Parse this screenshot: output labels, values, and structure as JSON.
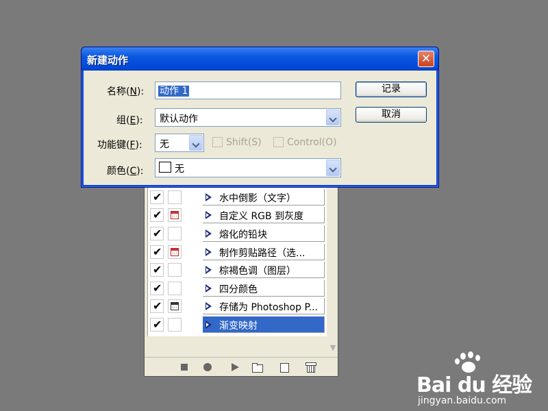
{
  "dialog": {
    "title": "新建动作",
    "fields": {
      "name": {
        "label_prefix": "名称(",
        "hotkey": "N",
        "label_suffix": "):",
        "value": "动作 1"
      },
      "set": {
        "label_prefix": "组(",
        "hotkey": "E",
        "label_suffix": "):",
        "value": "默认动作"
      },
      "function_key": {
        "label_prefix": "功能键(",
        "hotkey": "F",
        "label_suffix": "):",
        "value": "无"
      },
      "shift": {
        "label": "Shift(S)"
      },
      "control": {
        "label": "Control(O)"
      },
      "color": {
        "label_prefix": "颜色(",
        "hotkey": "C",
        "label_suffix": "):",
        "value": "无"
      }
    },
    "buttons": {
      "record": "记录",
      "cancel": "取消"
    }
  },
  "actions_panel": {
    "items": [
      {
        "label": "水中倒影（文字）",
        "checked": true,
        "dialog_toggle": false
      },
      {
        "label": "自定义 RGB 到灰度",
        "checked": true,
        "dialog_toggle": true
      },
      {
        "label": "熔化的铅块",
        "checked": true,
        "dialog_toggle": false
      },
      {
        "label": "制作剪贴路径（选...",
        "checked": true,
        "dialog_toggle": true
      },
      {
        "label": "棕褐色调（图层）",
        "checked": true,
        "dialog_toggle": false
      },
      {
        "label": "四分颜色",
        "checked": true,
        "dialog_toggle": false
      },
      {
        "label": "存储为 Photoshop P...",
        "checked": true,
        "dialog_toggle": true
      },
      {
        "label": "渐变映射",
        "checked": true,
        "dialog_toggle": false,
        "selected": true
      }
    ],
    "check_mark": "✔",
    "toolbar_icons": [
      "stop-icon",
      "record-icon",
      "play-icon",
      "folder-icon",
      "new-action-icon",
      "trash-icon"
    ]
  },
  "watermark": {
    "brand": "Bai du 经验",
    "url": "jingyan.baidu.com"
  },
  "colors": {
    "titlebar": "#0a58e0",
    "selection": "#3268c8",
    "desktop": "#7a7a7a"
  }
}
